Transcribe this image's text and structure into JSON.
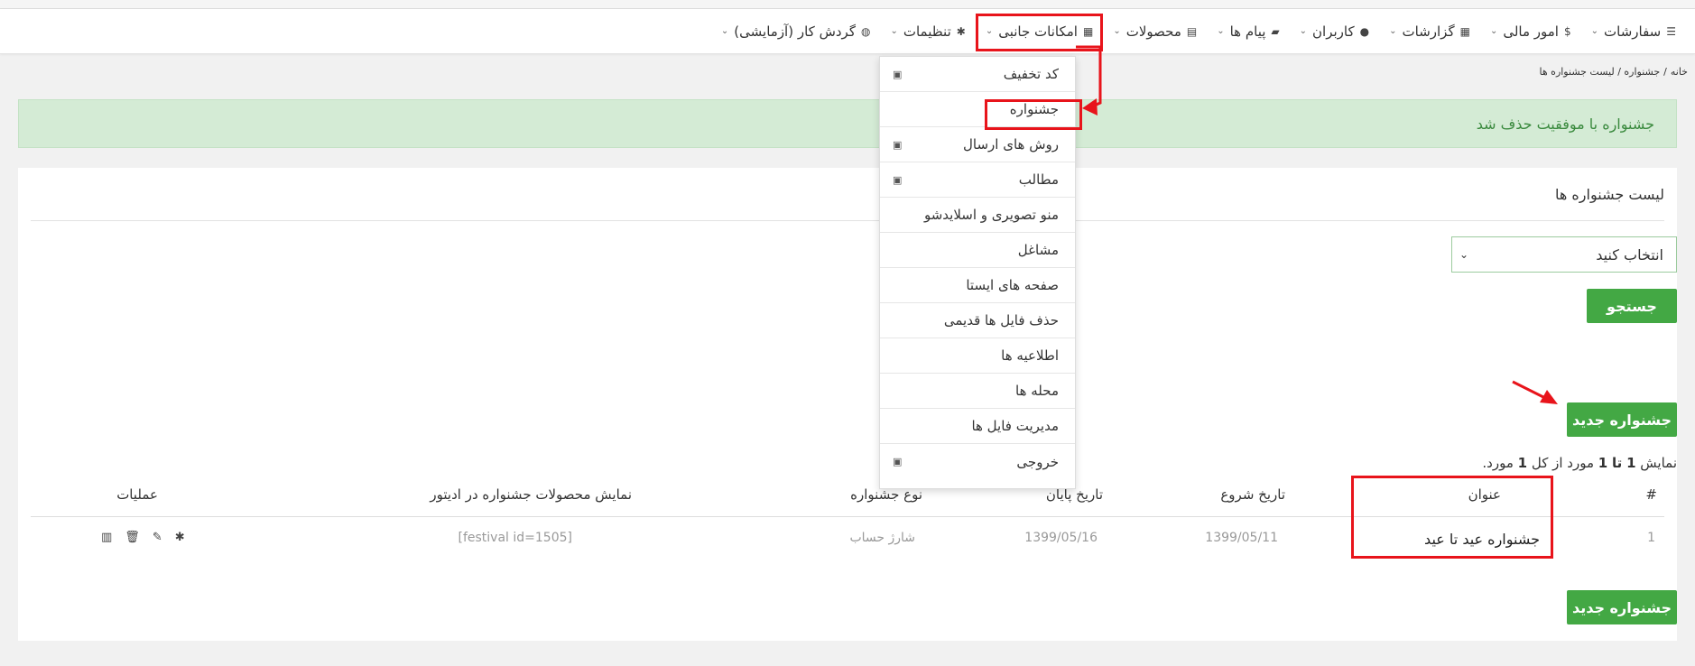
{
  "nav": {
    "items": [
      {
        "label": "سفارشات",
        "icon": "list-icon"
      },
      {
        "label": "امور مالی",
        "icon": "$"
      },
      {
        "label": "گزارشات",
        "icon": "chart-icon"
      },
      {
        "label": "کاربران",
        "icon": "user-icon"
      },
      {
        "label": "پیام ها",
        "icon": "message-icon"
      },
      {
        "label": "محصولات",
        "icon": "store-icon"
      },
      {
        "label": "امکانات جانبی",
        "icon": "grid-icon"
      },
      {
        "label": "تنظیمات",
        "icon": "gear-icon"
      },
      {
        "label": "گردش کار (آزمایشی)",
        "icon": "globe-icon"
      }
    ]
  },
  "breadcrumb": {
    "home": "خانه",
    "sep": "/",
    "current": "جشنواره / لیست جشنواره ها"
  },
  "alert": {
    "text": "جشنواره با موفقیت حذف شد"
  },
  "panel": {
    "title": "لیست جشنواره ها",
    "select_value": "انتخاب کنید",
    "search_label": "جستجو",
    "new_label": "جشنواره جدید",
    "count_prefix": "نمایش",
    "count_from": "1",
    "count_to_word": "تا",
    "count_to": "1",
    "count_of": "مورد از کل",
    "count_total": "1",
    "count_suffix": "مورد."
  },
  "table": {
    "headers": [
      "#",
      "عنوان",
      "تاریخ شروع",
      "تاریخ پایان",
      "نوع جشنواره",
      "نمایش محصولات جشنواره در ادیتور",
      "عملیات"
    ],
    "rows": [
      {
        "num": "1",
        "title": "جشنواره عید تا عید",
        "start": "1399/05/11",
        "end": "1399/05/16",
        "type": "شارژ حساب",
        "shortcode": "[festival id=1505]"
      }
    ]
  },
  "dropdown": {
    "items": [
      {
        "label": "کد تخفیف",
        "badge": true
      },
      {
        "label": "جشنواره",
        "badge": false
      },
      {
        "label": "روش های ارسال",
        "badge": true
      },
      {
        "label": "مطالب",
        "badge": true
      },
      {
        "label": "منو تصویری و اسلایدشو",
        "badge": false
      },
      {
        "label": "مشاغل",
        "badge": false
      },
      {
        "label": "صفحه های ایستا",
        "badge": false
      },
      {
        "label": "حذف فایل ها قدیمی",
        "badge": false
      },
      {
        "label": "اطلاعیه ها",
        "badge": false
      },
      {
        "label": "محله ها",
        "badge": false
      },
      {
        "label": "مدیریت فایل ها",
        "badge": false
      },
      {
        "label": "خروجی",
        "badge": true
      }
    ]
  },
  "colors": {
    "accent": "#43a844",
    "highlight": "#e8141b",
    "alert_bg": "#d4ebd5"
  }
}
